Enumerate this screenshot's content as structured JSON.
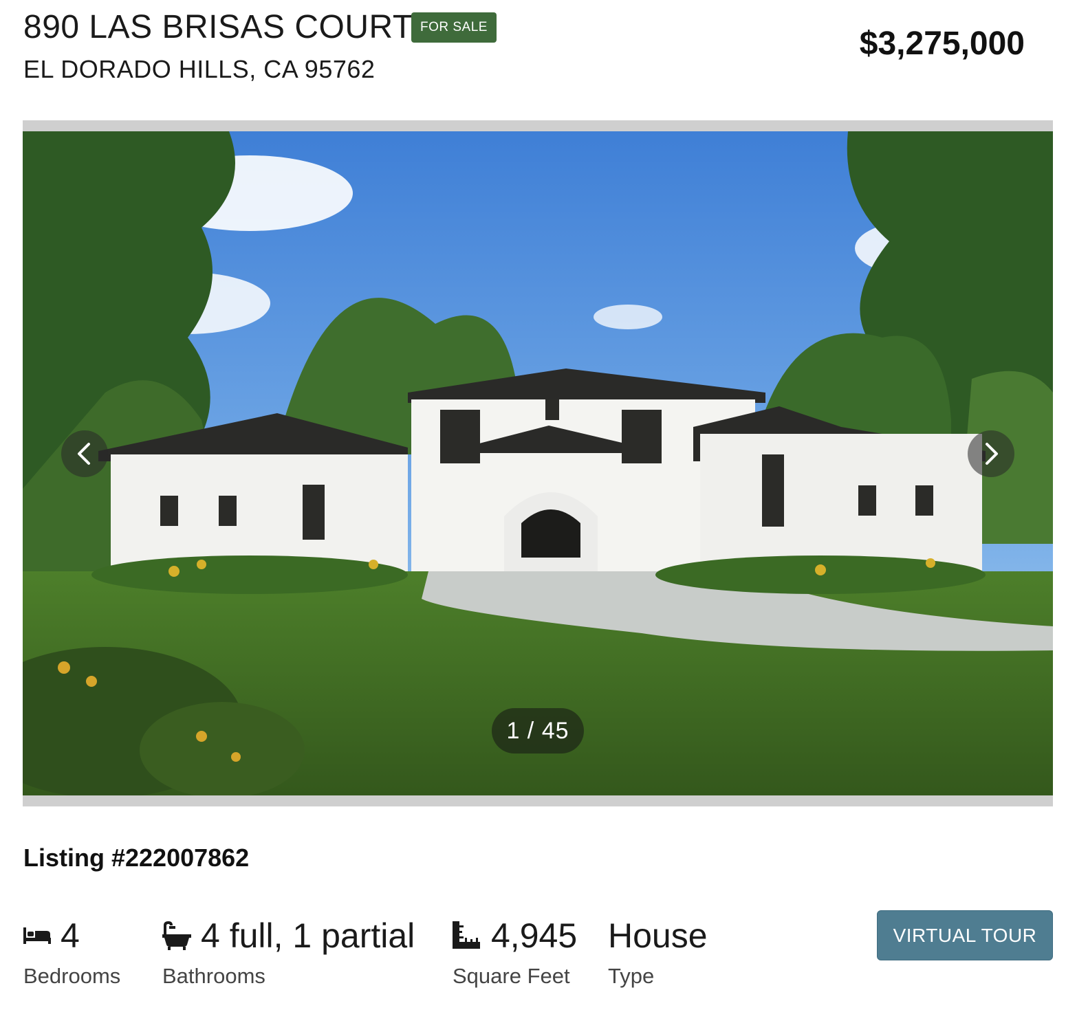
{
  "header": {
    "address_line1": "890 LAS BRISAS COURT",
    "status_badge": "FOR SALE",
    "address_line2": "EL DORADO HILLS, CA 95762",
    "price": "$3,275,000"
  },
  "gallery": {
    "counter": "1 / 45",
    "prev_icon": "chevron-left-icon",
    "next_icon": "chevron-right-icon"
  },
  "listing": {
    "number_label": "Listing #222007862"
  },
  "stats": [
    {
      "icon": "bed-icon",
      "value": "4",
      "label": "Bedrooms"
    },
    {
      "icon": "bathtub-icon",
      "value": "4 full, 1 partial",
      "label": "Bathrooms"
    },
    {
      "icon": "ruler-icon",
      "value": "4,945",
      "label": "Square Feet"
    },
    {
      "icon": "",
      "value": "House",
      "label": "Type"
    }
  ],
  "actions": {
    "virtual_tour": "VIRTUAL TOUR"
  },
  "colors": {
    "badge_green": "#3f6b3b",
    "tour_button": "#4f7d91"
  }
}
